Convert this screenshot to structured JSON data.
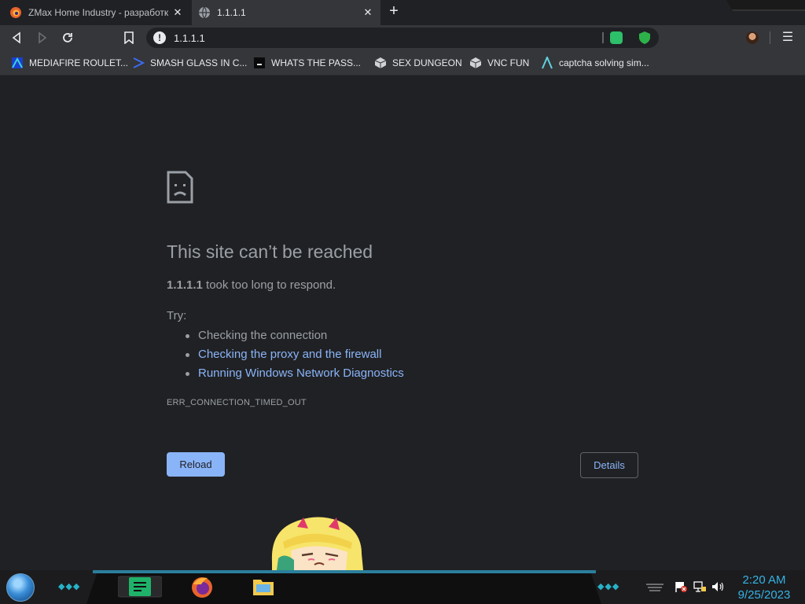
{
  "tabs": [
    {
      "title": "ZMax Home Industry - разработк",
      "favicon": "firefox-like-orange-icon",
      "active": false
    },
    {
      "title": "1.1.1.1",
      "favicon": "globe-icon",
      "active": true
    }
  ],
  "toolbar": {
    "url": "1.1.1.1",
    "info_icon": "!"
  },
  "bookmarks": [
    {
      "label": "MEDIAFIRE ROULET...",
      "icon": "mediafire-icon"
    },
    {
      "label": "SMASH GLASS IN C...",
      "icon": "bracket-icon"
    },
    {
      "label": "WHATS THE PASS...",
      "icon": "dark-square-icon"
    },
    {
      "label": "SEX DUNGEON",
      "icon": "cube-icon"
    },
    {
      "label": "VNC FUN",
      "icon": "cube-icon"
    },
    {
      "label": "captcha solving sim...",
      "icon": "lambda-icon"
    }
  ],
  "error": {
    "title": "This site can’t be reached",
    "host": "1.1.1.1",
    "message": " took too long to respond.",
    "try_label": "Try:",
    "suggestions": [
      "Checking the connection",
      "Checking the proxy and the firewall",
      "Running Windows Network Diagnostics"
    ],
    "code": "ERR_CONNECTION_TIMED_OUT",
    "reload_label": "Reload",
    "details_label": "Details"
  },
  "clock": {
    "time": "2:20 AM",
    "date": "9/25/2023"
  },
  "colors": {
    "accent": "#8ab4f8",
    "taskbar_accent": "#35b3e6"
  }
}
